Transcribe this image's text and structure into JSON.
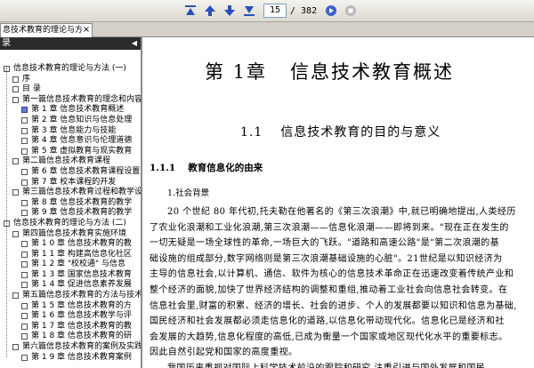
{
  "toolbar": {
    "buttons": [
      "first-page-icon",
      "prev-page-icon",
      "next-page-icon",
      "last-page-icon"
    ],
    "current_page": "15",
    "total_pages": "/ 382",
    "extra_icons": [
      "go-icon",
      "stop-icon"
    ],
    "accent": "#2a4fb8"
  },
  "tab": {
    "title": "息技术教育的理论与方...",
    "close": "×"
  },
  "sidebar": {
    "header": "录",
    "collapse_arrow": "◀",
    "items": [
      {
        "text": "信息技术教育的理论与方法 (一)",
        "level": 0
      },
      {
        "text": "序",
        "level": 1
      },
      {
        "text": "目 录",
        "level": 1
      },
      {
        "text": "第一篇信息技术教育的理念和内容",
        "level": 1
      },
      {
        "text": "第 1 章  信息技术教育概述",
        "level": 2,
        "selected": true
      },
      {
        "text": "第 2 章  信息知识与信息处理",
        "level": 2
      },
      {
        "text": "第 3 章  信息能力与技能",
        "level": 2
      },
      {
        "text": "第 4 章  信息意识与伦理道德",
        "level": 2
      },
      {
        "text": "第 5 章  虚拟教育与现实教育",
        "level": 2
      },
      {
        "text": "第二篇信息技术教育课程",
        "level": 1
      },
      {
        "text": "第 6 章  信息技术教育课程设置",
        "level": 2
      },
      {
        "text": "第 7 章  校本课程的开发",
        "level": 2
      },
      {
        "text": "第三篇信息技术教育过程和教学设计",
        "level": 1
      },
      {
        "text": "第 8 章  信息技术教育的教学",
        "level": 2
      },
      {
        "text": "第 9 章  信息技术教育的教学",
        "level": 2
      },
      {
        "text": "信息技术教育的理论与方法 (二)",
        "level": 0
      },
      {
        "text": "第四篇信息技术教育实施环境",
        "level": 1
      },
      {
        "text": "第 1 0 章  信息技术教育的教",
        "level": 2
      },
      {
        "text": "第 1 1 章  构建高信息化社区",
        "level": 2
      },
      {
        "text": "第 1 2 章  \"校校通\" 与信息",
        "level": 2
      },
      {
        "text": "第 1 3 章  国家信息技术教育",
        "level": 2
      },
      {
        "text": "第 1 4 章  促进信息素养发展",
        "level": 2
      },
      {
        "text": "第五篇信息技术教育的方法与技术",
        "level": 1
      },
      {
        "text": "第 1 5 章  信息技术教育的方",
        "level": 2
      },
      {
        "text": "第 1 6 章  信息技术教学与评",
        "level": 2
      },
      {
        "text": "第 1 7 章  信息技术教育的教",
        "level": 2
      },
      {
        "text": "第 1 8 章  信息技术教育的研",
        "level": 2
      },
      {
        "text": "第六篇信息技术教育的案例及实践",
        "level": 1
      },
      {
        "text": "第 1 9 章  信息技术教育案例",
        "level": 2
      }
    ]
  },
  "document": {
    "chapter_num": "第 1章",
    "chapter_title": "信息技术教育概述",
    "section_num": "1.1",
    "section_title": "信息技术教育的目的与意义",
    "subsection_num": "1.1.1",
    "subsection_title": "教育信息化的由来",
    "subsubsection": "1.社会背景",
    "paragraph_lines": [
      "20 个世纪 80 年代初,托夫勒在他著名的《第三次浪潮》中,就已明确地提出,人类经历",
      "了农业化浪潮和工业化浪潮,第三次浪潮——信息化浪潮——即将到来。\"现在正在发生的",
      "一切无疑是一场全球性的革命,一场巨大的飞跃。\"道路和高速公路\"是\"第二次浪潮的基",
      "础设施的组成部分,数字网络则是第三次浪潮基础设施的心脏\"。21世纪是以知识经济为",
      "主导的信息社会,以计算机、通信、软件为核心的信息技术革命正在迅速改变着传统产业和",
      "整个经济的面貌,加快了世界经济结构的调整和重组,推动着工业社会向信息社会转变。在",
      "信息社会里,财富的积累、经济的增长、社会的进步、个人的发展都要以知识和信息为基础,",
      "国民经济和社会发展都必须走信息化的道路,以信息化带动现代化。信息化已是经济和社",
      "会发展的大趋势,信息化程度的高低,已成为衡量一个国家或地区现代化水平的重要标志。",
      "因此自然引起党和国家的高度重视。",
      "我国历来重视对国际上科学技术前沿的跟踪和研究,注重引进与国外发展和国民"
    ]
  }
}
